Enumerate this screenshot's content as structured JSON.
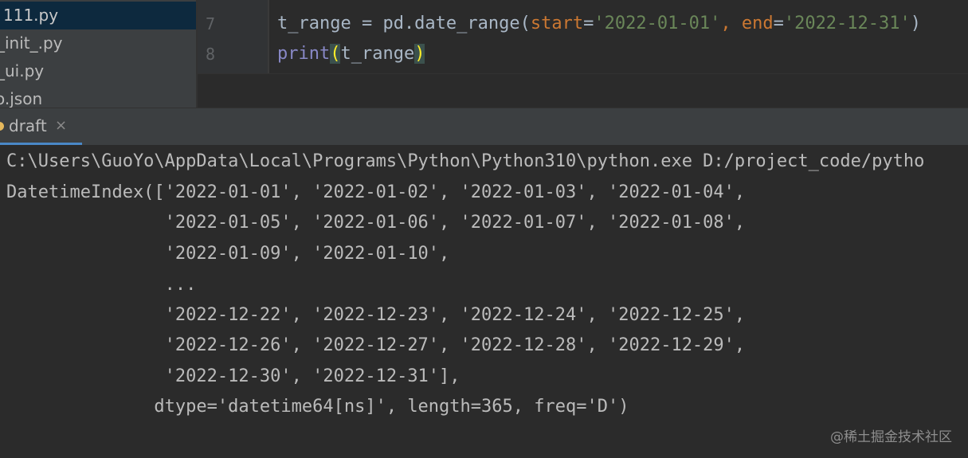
{
  "project_tree": {
    "items": [
      {
        "label": "111.py",
        "selected": true
      },
      {
        "label": "_init_.py",
        "selected": false
      },
      {
        "label": "_ui.py",
        "selected": false
      },
      {
        "label": "o.json",
        "selected": false
      }
    ]
  },
  "editor": {
    "lines": [
      {
        "number": "7",
        "tokens": [
          {
            "text": "t_range = pd.date_range(",
            "kind": "plain"
          },
          {
            "text": "start",
            "kind": "param"
          },
          {
            "text": "=",
            "kind": "plain"
          },
          {
            "text": "'2022-01-01'",
            "kind": "string"
          },
          {
            "text": ", ",
            "kind": "param"
          },
          {
            "text": "end",
            "kind": "param"
          },
          {
            "text": "=",
            "kind": "plain"
          },
          {
            "text": "'2022-12-31'",
            "kind": "string"
          },
          {
            "text": ")",
            "kind": "plain"
          }
        ]
      },
      {
        "number": "8",
        "tokens": [
          {
            "text": "print",
            "kind": "builtin"
          },
          {
            "text": "(",
            "kind": "paren-match"
          },
          {
            "text": "t_range",
            "kind": "plain"
          },
          {
            "text": ")",
            "kind": "paren-match"
          }
        ]
      }
    ]
  },
  "run_tool": {
    "tab_label": "draft",
    "close_glyph": "×"
  },
  "console": {
    "lines": [
      "C:\\Users\\GuoYo\\AppData\\Local\\Programs\\Python\\Python310\\python.exe D:/project_code/pytho",
      "DatetimeIndex(['2022-01-01', '2022-01-02', '2022-01-03', '2022-01-04',",
      "               '2022-01-05', '2022-01-06', '2022-01-07', '2022-01-08',",
      "               '2022-01-09', '2022-01-10',",
      "               ...",
      "               '2022-12-22', '2022-12-23', '2022-12-24', '2022-12-25',",
      "               '2022-12-26', '2022-12-27', '2022-12-28', '2022-12-29',",
      "               '2022-12-30', '2022-12-31'],",
      "              dtype='datetime64[ns]', length=365, freq='D')"
    ]
  },
  "watermark": "@稀土掘金技术社区"
}
